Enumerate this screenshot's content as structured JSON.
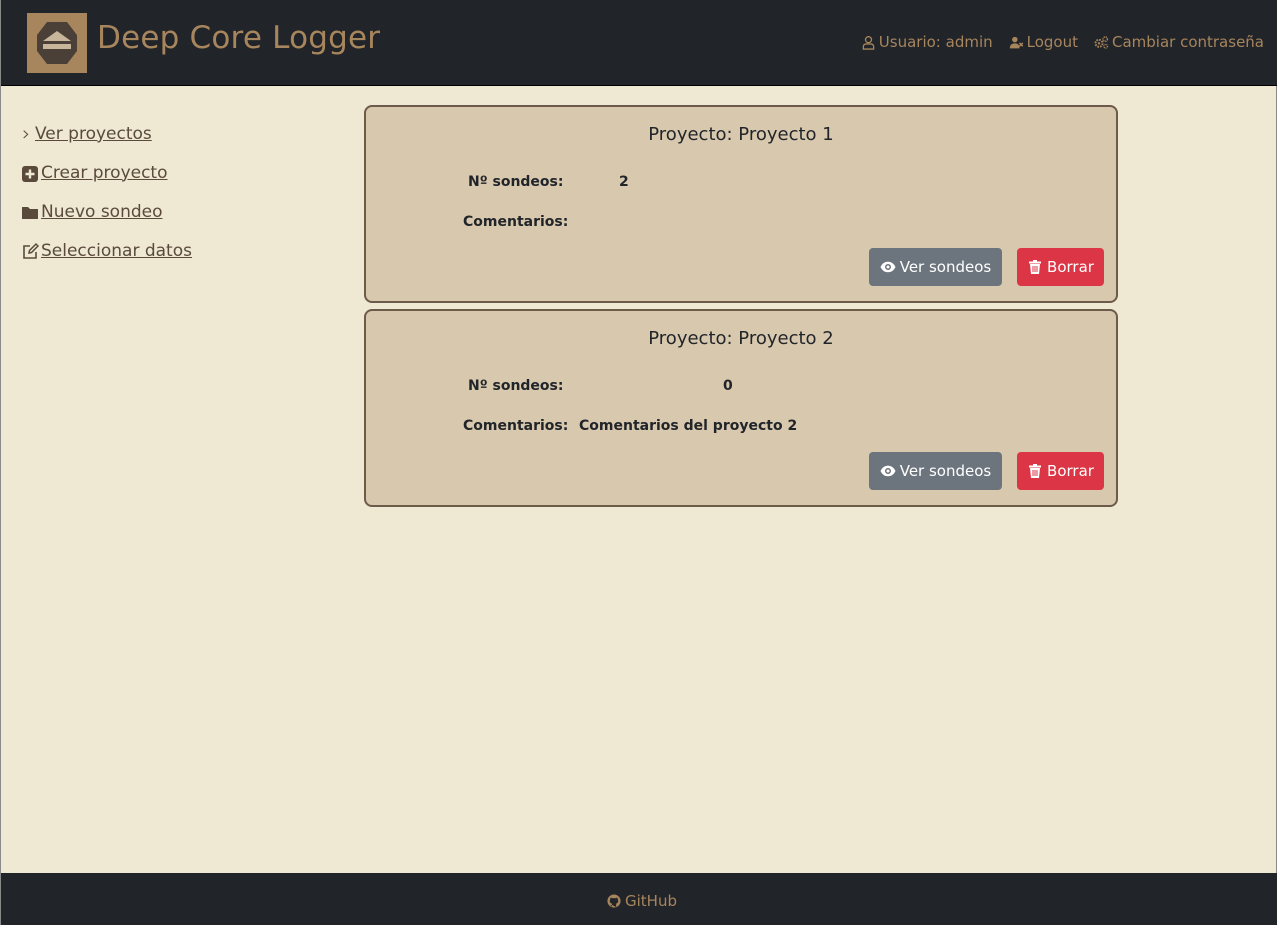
{
  "header": {
    "brand": "Deep Core Logger",
    "user_label": "Usuario: admin",
    "logout_label": "Logout",
    "change_password_label": "Cambiar contraseña",
    "accent_color": "#a7855d",
    "bg_color": "#212429"
  },
  "sidebar": {
    "items": [
      {
        "label": "Ver proyectos",
        "icon": "chevron-right-icon"
      },
      {
        "label": "Crear proyecto",
        "icon": "plus-square-icon"
      },
      {
        "label": "Nuevo sondeo",
        "icon": "folder-icon"
      },
      {
        "label": "Seleccionar datos",
        "icon": "edit-icon"
      }
    ]
  },
  "projects": [
    {
      "title": "Proyecto: Proyecto 1",
      "sondeos_label": "Nº sondeos:",
      "sondeos_value": "2",
      "comentarios_label": "Comentarios:",
      "comentarios_value": "",
      "view_label": "Ver sondeos",
      "delete_label": "Borrar"
    },
    {
      "title": "Proyecto: Proyecto 2",
      "sondeos_label": "Nº sondeos:",
      "sondeos_value": "0",
      "comentarios_label": "Comentarios:",
      "comentarios_value": "Comentarios del proyecto 2",
      "view_label": "Ver sondeos",
      "delete_label": "Borrar"
    }
  ],
  "footer": {
    "github_label": "GitHub"
  }
}
